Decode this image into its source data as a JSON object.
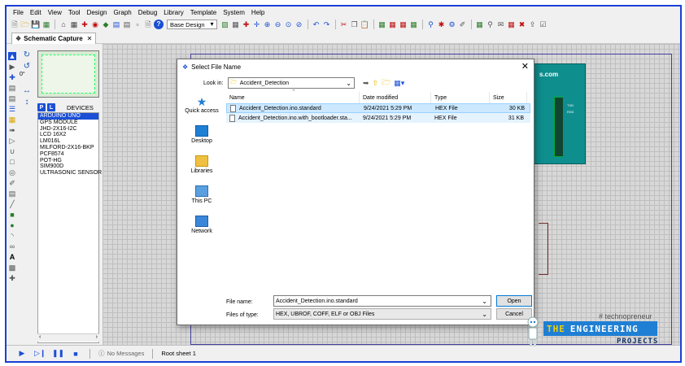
{
  "menu": [
    "File",
    "Edit",
    "View",
    "Tool",
    "Design",
    "Graph",
    "Debug",
    "Library",
    "Template",
    "System",
    "Help"
  ],
  "toolbar": {
    "design_combo": "Base Design"
  },
  "tab": {
    "label": "Schematic Capture"
  },
  "rotation": {
    "angle": "0°"
  },
  "devices": {
    "p_label": "P",
    "l_label": "L",
    "header": "DEVICES",
    "items": [
      "ARDUINO UNO",
      "GPS MODULE",
      "JHD-2X16-I2C",
      "LCD 16X2",
      "LM016L",
      "MILFORD-2X16-BKP",
      "PCF8574",
      "POT-HG",
      "SIM900D",
      "ULTRASONIC SENSOR"
    ],
    "selected_index": 0
  },
  "canvas": {
    "board_text": "s.com",
    "board_pin1": "TXD",
    "board_pin2": "RXD"
  },
  "dialog": {
    "title": "Select File Name",
    "look_in_label": "Look in:",
    "look_in_value": "Accident_Detection",
    "places": [
      "Quick access",
      "Desktop",
      "Libraries",
      "This PC",
      "Network"
    ],
    "columns": {
      "name": "Name",
      "date": "Date modified",
      "type": "Type",
      "size": "Size"
    },
    "files": [
      {
        "name": "Accident_Detection.ino.standard",
        "date": "9/24/2021 5:29 PM",
        "type": "HEX File",
        "size": "30 KB"
      },
      {
        "name": "Accident_Detection.ino.with_bootloader.sta...",
        "date": "9/24/2021 5:29 PM",
        "type": "HEX File",
        "size": "31 KB"
      }
    ],
    "file_name_label": "File name:",
    "file_name_value": "Accident_Detection.ino.standard",
    "file_type_label": "Files of type:",
    "file_type_value": "HEX, UBROF, COFF, ELF or OBJ Files",
    "open_label": "Open",
    "cancel_label": "Cancel"
  },
  "status": {
    "messages": "No Messages",
    "sheet": "Root sheet 1"
  },
  "watermark": {
    "tag": "# technopreneur",
    "the": "THE",
    "brand": "ENGINEERING",
    "projects": "PROJECTS"
  },
  "colors": {
    "frame": "#1b3fd6",
    "accent": "#1b4fd6",
    "selection": "#cce8ff",
    "board": "#0f8e8e",
    "watermark_banner": "#1e7fd4"
  }
}
